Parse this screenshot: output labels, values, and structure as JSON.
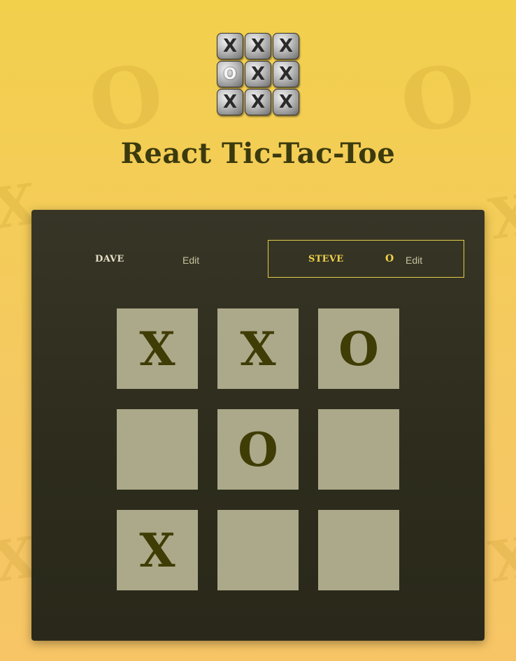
{
  "app": {
    "title": "React Tic-Tac-Toe"
  },
  "logo": {
    "tiles": [
      "X",
      "X",
      "X",
      "O",
      "X",
      "X",
      "X",
      "X",
      "X"
    ]
  },
  "background_glyphs": [
    "O",
    "O",
    "X",
    "X",
    "X",
    "X"
  ],
  "players": [
    {
      "name": "DAVE",
      "symbol": "",
      "edit_label": "Edit",
      "active": false
    },
    {
      "name": "STEVE",
      "symbol": "O",
      "edit_label": "Edit",
      "active": true
    }
  ],
  "board": {
    "cells": [
      "X",
      "X",
      "O",
      "",
      "O",
      "",
      "X",
      "",
      ""
    ]
  },
  "colors": {
    "background": "#f2d04c",
    "panel": "#2f2d1e",
    "cell": "#aca98a",
    "mark": "#3f3c06",
    "active_accent": "#e3cd46",
    "title": "#3b3a0e"
  }
}
